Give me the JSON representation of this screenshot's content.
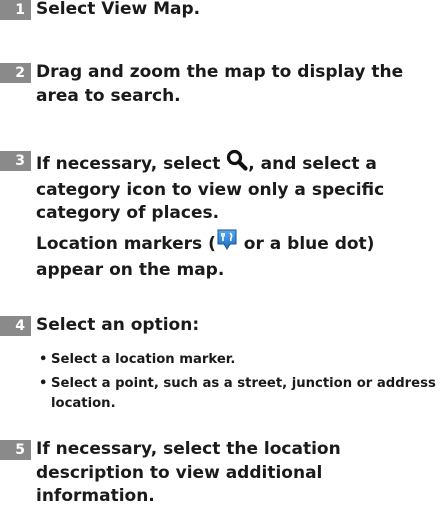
{
  "steps": [
    {
      "number": "1",
      "text": "Select View Map."
    },
    {
      "number": "2",
      "text": "Drag and zoom the map to display the area to search."
    },
    {
      "number": "3",
      "before_icon": "If necessary, select ",
      "icon": "magnifying-glass-icon",
      "after_icon": ", and select a category icon to view only a specific category of places."
    },
    {
      "number": "4",
      "text": "Select an option:"
    },
    {
      "number": "5",
      "text": "If necessary, select the location description to view additional information."
    }
  ],
  "note": {
    "before_icon": "Location markers (",
    "icon": "restaurant-marker-icon",
    "after_icon": " or a blue dot) appear on the map."
  },
  "options": [
    "Select a location marker.",
    "Select a point, such as a street, junction or address location."
  ],
  "bullet_char": "•",
  "colors": {
    "step_badge": "#8a8a8a",
    "marker_blue": "#1e6fc4",
    "marker_blue_light": "#5aa7e8"
  }
}
